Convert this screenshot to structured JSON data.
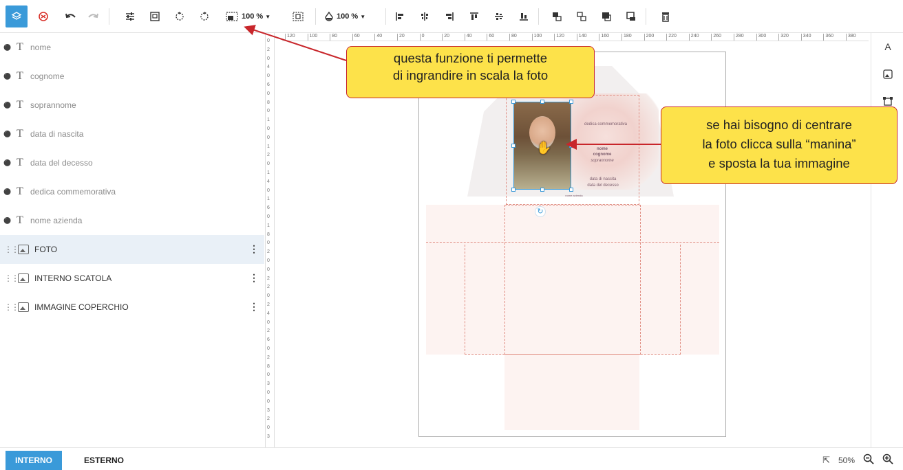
{
  "toolbar": {
    "icons": [
      "layers-icon",
      "history-icon",
      "undo-icon",
      "redo-icon",
      "adjust-icon",
      "image-frame-icon",
      "rotate-left-icon",
      "rotate-right-icon",
      "image-scale-icon",
      "crop-icon",
      "opacity-icon",
      "align-left-icon",
      "align-center-v-icon",
      "align-right-icon",
      "align-top-icon",
      "align-middle-icon",
      "align-bottom-icon",
      "bring-forward-icon",
      "send-backward-icon",
      "bring-front-icon",
      "send-back-icon",
      "delete-icon"
    ],
    "scale_value": "100 %",
    "opacity_value": "100 %",
    "accent_color": "#3a9ad9"
  },
  "layers": [
    {
      "type": "text",
      "label": "nome",
      "locked": true
    },
    {
      "type": "text",
      "label": "cognome",
      "locked": true
    },
    {
      "type": "text",
      "label": "soprannome",
      "locked": true
    },
    {
      "type": "text",
      "label": "data di nascita",
      "locked": true
    },
    {
      "type": "text",
      "label": "data del decesso",
      "locked": true
    },
    {
      "type": "text",
      "label": "dedica commemorativa",
      "locked": true
    },
    {
      "type": "text",
      "label": "nome azienda",
      "locked": true
    },
    {
      "type": "image",
      "label": "FOTO",
      "selected": true
    },
    {
      "type": "image",
      "label": "INTERNO SCATOLA",
      "selected": false
    },
    {
      "type": "image",
      "label": "IMMAGINE COPERCHIO",
      "selected": false
    }
  ],
  "hruler": [
    "120",
    "100",
    "80",
    "60",
    "40",
    "20",
    "0",
    "20",
    "40",
    "60",
    "80",
    "100",
    "120",
    "140",
    "160",
    "180",
    "200",
    "220",
    "240",
    "260",
    "280",
    "300",
    "320",
    "340",
    "360",
    "380"
  ],
  "vruler": [
    "0",
    "2",
    "0",
    "4",
    "0",
    "6",
    "0",
    "8",
    "0",
    "1",
    "0",
    "0",
    "1",
    "2",
    "0",
    "1",
    "4",
    "0",
    "1",
    "6",
    "0",
    "1",
    "8",
    "0",
    "2",
    "0",
    "0",
    "2",
    "2",
    "0",
    "2",
    "4",
    "0",
    "2",
    "6",
    "0",
    "2",
    "8",
    "0",
    "3",
    "0",
    "0",
    "3",
    "2",
    "0",
    "3"
  ],
  "card": {
    "dedica": "dedica commemorativa",
    "nome": "nome",
    "cognome": "cognome",
    "soprannome": "soprannome",
    "nascita": "data di nascita",
    "decesso": "data del decesso",
    "azienda": "nome azienda"
  },
  "callouts": {
    "first_line1": "questa funzione ti permette",
    "first_line2": "di ingrandire in scala la foto",
    "second_line1": "se hai bisogno di centrare",
    "second_line2": "la  foto clicca sulla “manina”",
    "second_line3": "e sposta la tua immagine"
  },
  "right_tools": [
    "text-tool-icon",
    "image-tool-icon",
    "shape-tool-icon"
  ],
  "tabs": {
    "interno": "INTERNO",
    "esterno": "ESTERNO"
  },
  "zoom": {
    "value": "50%",
    "icons": [
      "fullscreen-icon",
      "zoom-out-icon",
      "zoom-in-icon"
    ]
  }
}
